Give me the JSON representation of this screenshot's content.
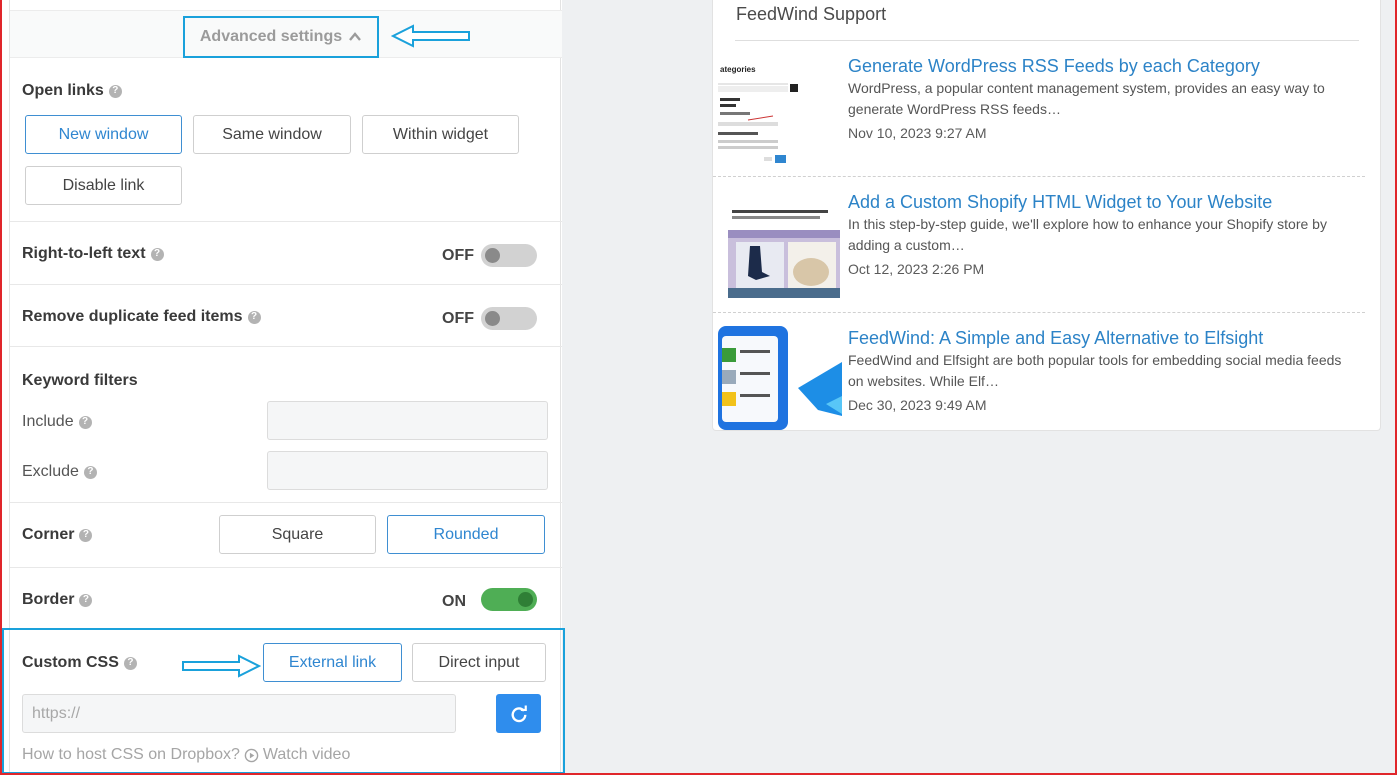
{
  "advanced": {
    "title": "Advanced settings"
  },
  "open_links": {
    "label": "Open links",
    "options": [
      "New window",
      "Same window",
      "Within widget",
      "Disable link"
    ],
    "selected": "New window"
  },
  "rtl": {
    "label": "Right-to-left text",
    "state": "OFF"
  },
  "dedupe": {
    "label": "Remove duplicate feed items",
    "state": "OFF"
  },
  "keywords": {
    "label": "Keyword filters",
    "include_label": "Include",
    "exclude_label": "Exclude",
    "include_value": "",
    "exclude_value": ""
  },
  "corner": {
    "label": "Corner",
    "options": [
      "Square",
      "Rounded"
    ],
    "selected": "Rounded"
  },
  "border": {
    "label": "Border",
    "state": "ON"
  },
  "custom_css": {
    "label": "Custom CSS",
    "options": [
      "External link",
      "Direct input"
    ],
    "selected": "External link",
    "url_placeholder": "https://",
    "help_text": "How to host CSS on Dropbox?",
    "watch_video": "Watch video"
  },
  "widget": {
    "title": "FeedWind Support",
    "items": [
      {
        "title": "Generate WordPress RSS Feeds by each Category",
        "desc": "WordPress, a popular content management system, provides an easy way to generate WordPress RSS feeds…",
        "date": "Nov 10, 2023 9:27 AM",
        "thumb_text": "ategories"
      },
      {
        "title": "Add a Custom Shopify HTML Widget to Your Website",
        "desc": "In this step-by-step guide, we'll explore how to enhance your Shopify store by adding a custom…",
        "date": "Oct 12, 2023 2:26 PM"
      },
      {
        "title": "FeedWind: A Simple and Easy Alternative to Elfsight",
        "desc": "FeedWind and Elfsight are both popular tools for embedding social media feeds on websites. While Elf…",
        "date": "Dec 30, 2023 9:49 AM"
      }
    ]
  },
  "colors": {
    "accent_blue": "#2f86d0",
    "annotation_blue": "#1aa1db",
    "frame_red": "#e0262b",
    "toggle_on": "#4fae55"
  }
}
